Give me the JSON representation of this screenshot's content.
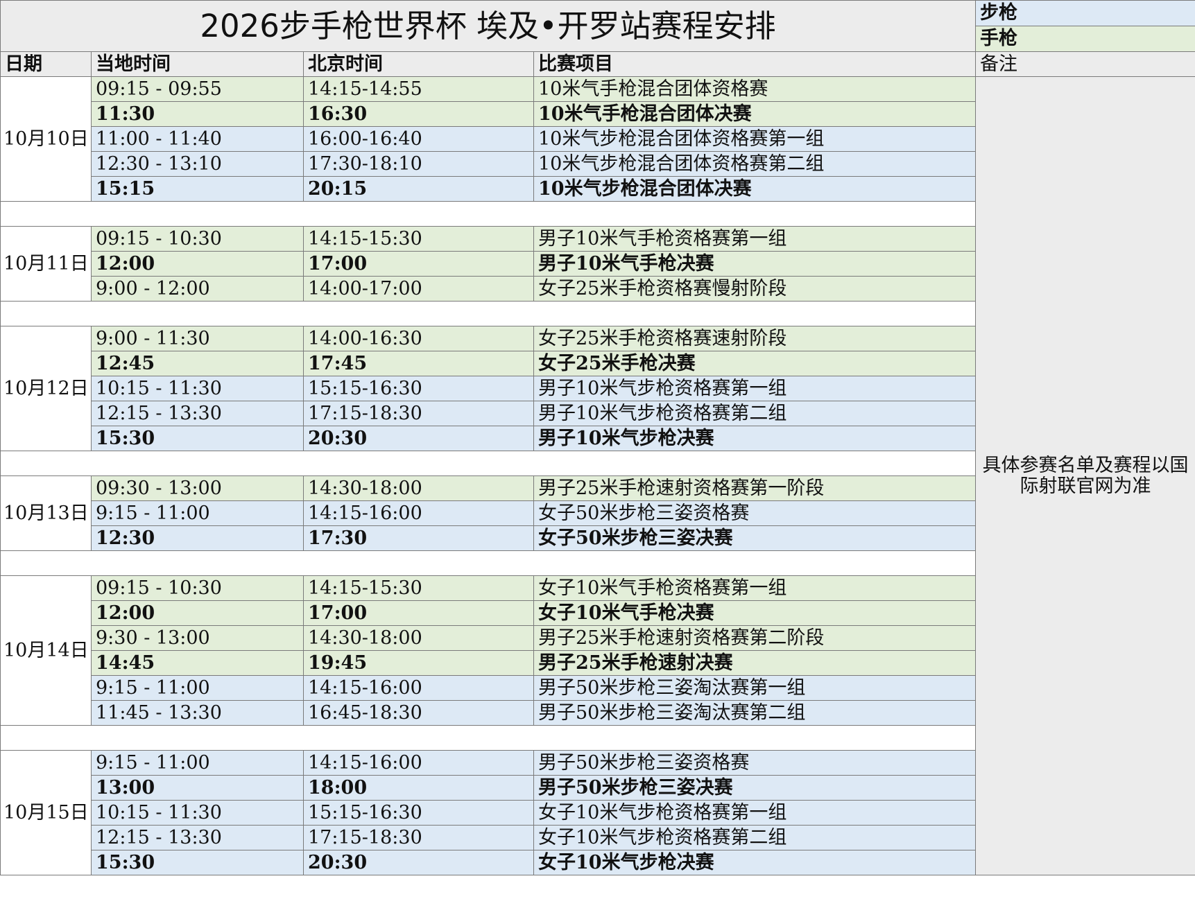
{
  "title": "2026步手枪世界杯 埃及•开罗站赛程安排",
  "legend": {
    "rifle": "步枪",
    "pistol": "手枪"
  },
  "headers": {
    "date": "日期",
    "local": "当地时间",
    "beijing": "北京时间",
    "event": "比赛项目",
    "remark": "备注"
  },
  "remark": "具体参赛名单及赛程以国际射联官网为准",
  "colors": {
    "rifle": "#dde9f5",
    "pistol": "#e3eed9",
    "header": "#ececec"
  },
  "days": [
    {
      "date": "10月10日",
      "rows": [
        {
          "local": "09:15 - 09:55",
          "beijing": "14:15-14:55",
          "event": "10米气手枪混合团体资格赛",
          "type": "pistol",
          "final": false
        },
        {
          "local": "11:30",
          "beijing": "16:30",
          "event": "10米气手枪混合团体决赛",
          "type": "pistol",
          "final": true
        },
        {
          "local": "11:00 - 11:40",
          "beijing": "16:00-16:40",
          "event": "10米气步枪混合团体资格赛第一组",
          "type": "rifle",
          "final": false
        },
        {
          "local": "12:30 - 13:10",
          "beijing": "17:30-18:10",
          "event": "10米气步枪混合团体资格赛第二组",
          "type": "rifle",
          "final": false
        },
        {
          "local": "15:15",
          "beijing": "20:15",
          "event": "10米气步枪混合团体决赛",
          "type": "rifle",
          "final": true
        }
      ]
    },
    {
      "date": "10月11日",
      "rows": [
        {
          "local": "09:15 - 10:30",
          "beijing": "14:15-15:30",
          "event": "男子10米气手枪资格赛第一组",
          "type": "pistol",
          "final": false
        },
        {
          "local": "12:00",
          "beijing": "17:00",
          "event": "男子10米气手枪决赛",
          "type": "pistol",
          "final": true
        },
        {
          "local": "9:00 - 12:00",
          "beijing": "14:00-17:00",
          "event": "女子25米手枪资格赛慢射阶段",
          "type": "pistol",
          "final": false
        }
      ]
    },
    {
      "date": "10月12日",
      "rows": [
        {
          "local": "9:00 - 11:30",
          "beijing": "14:00-16:30",
          "event": "女子25米手枪资格赛速射阶段",
          "type": "pistol",
          "final": false
        },
        {
          "local": "12:45",
          "beijing": "17:45",
          "event": "女子25米手枪决赛",
          "type": "pistol",
          "final": true
        },
        {
          "local": "10:15 - 11:30",
          "beijing": "15:15-16:30",
          "event": "男子10米气步枪资格赛第一组",
          "type": "rifle",
          "final": false
        },
        {
          "local": "12:15 - 13:30",
          "beijing": "17:15-18:30",
          "event": "男子10米气步枪资格赛第二组",
          "type": "rifle",
          "final": false
        },
        {
          "local": "15:30",
          "beijing": "20:30",
          "event": "男子10米气步枪决赛",
          "type": "rifle",
          "final": true
        }
      ]
    },
    {
      "date": "10月13日",
      "rows": [
        {
          "local": "09:30 - 13:00",
          "beijing": "14:30-18:00",
          "event": "男子25米手枪速射资格赛第一阶段",
          "type": "pistol",
          "final": false
        },
        {
          "local": "9:15 - 11:00",
          "beijing": "14:15-16:00",
          "event": "女子50米步枪三姿资格赛",
          "type": "rifle",
          "final": false
        },
        {
          "local": "12:30",
          "beijing": "17:30",
          "event": "女子50米步枪三姿决赛",
          "type": "rifle",
          "final": true
        }
      ]
    },
    {
      "date": "10月14日",
      "rows": [
        {
          "local": "09:15 - 10:30",
          "beijing": "14:15-15:30",
          "event": "女子10米气手枪资格赛第一组",
          "type": "pistol",
          "final": false
        },
        {
          "local": "12:00",
          "beijing": "17:00",
          "event": "女子10米气手枪决赛",
          "type": "pistol",
          "final": true
        },
        {
          "local": "9:30 - 13:00",
          "beijing": "14:30-18:00",
          "event": "男子25米手枪速射资格赛第二阶段",
          "type": "pistol",
          "final": false
        },
        {
          "local": "14:45",
          "beijing": "19:45",
          "event": "男子25米手枪速射决赛",
          "type": "pistol",
          "final": true
        },
        {
          "local": "9:15 - 11:00",
          "beijing": "14:15-16:00",
          "event": "男子50米步枪三姿淘汰赛第一组",
          "type": "rifle",
          "final": false
        },
        {
          "local": "11:45 - 13:30",
          "beijing": "16:45-18:30",
          "event": "男子50米步枪三姿淘汰赛第二组",
          "type": "rifle",
          "final": false
        }
      ]
    },
    {
      "date": "10月15日",
      "rows": [
        {
          "local": "9:15 - 11:00",
          "beijing": "14:15-16:00",
          "event": "男子50米步枪三姿资格赛",
          "type": "rifle",
          "final": false
        },
        {
          "local": "13:00",
          "beijing": "18:00",
          "event": "男子50米步枪三姿决赛",
          "type": "rifle",
          "final": true
        },
        {
          "local": "10:15 - 11:30",
          "beijing": "15:15-16:30",
          "event": "女子10米气步枪资格赛第一组",
          "type": "rifle",
          "final": false
        },
        {
          "local": "12:15 - 13:30",
          "beijing": "17:15-18:30",
          "event": "女子10米气步枪资格赛第二组",
          "type": "rifle",
          "final": false
        },
        {
          "local": "15:30",
          "beijing": "20:30",
          "event": "女子10米气步枪决赛",
          "type": "rifle",
          "final": true
        }
      ]
    }
  ]
}
